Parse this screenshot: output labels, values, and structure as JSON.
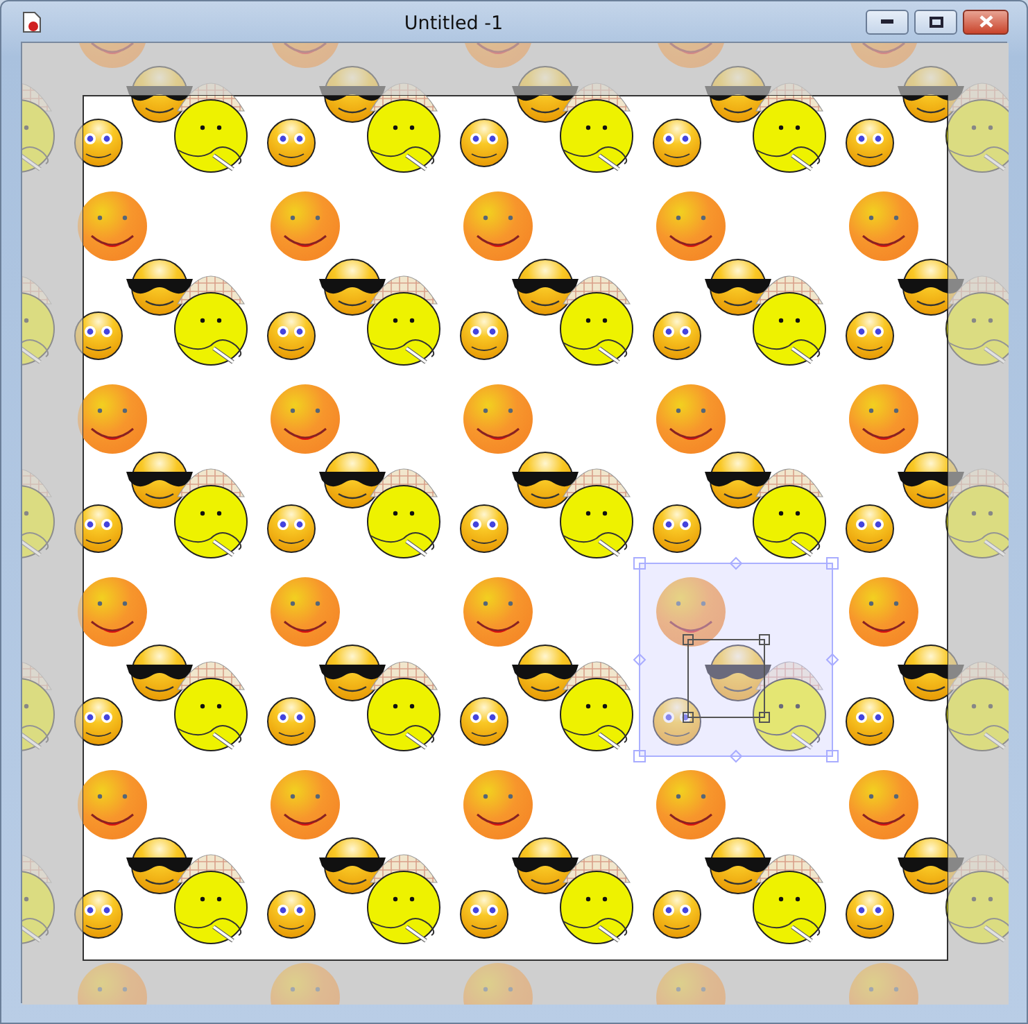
{
  "window": {
    "title": "Untitled -1"
  }
}
